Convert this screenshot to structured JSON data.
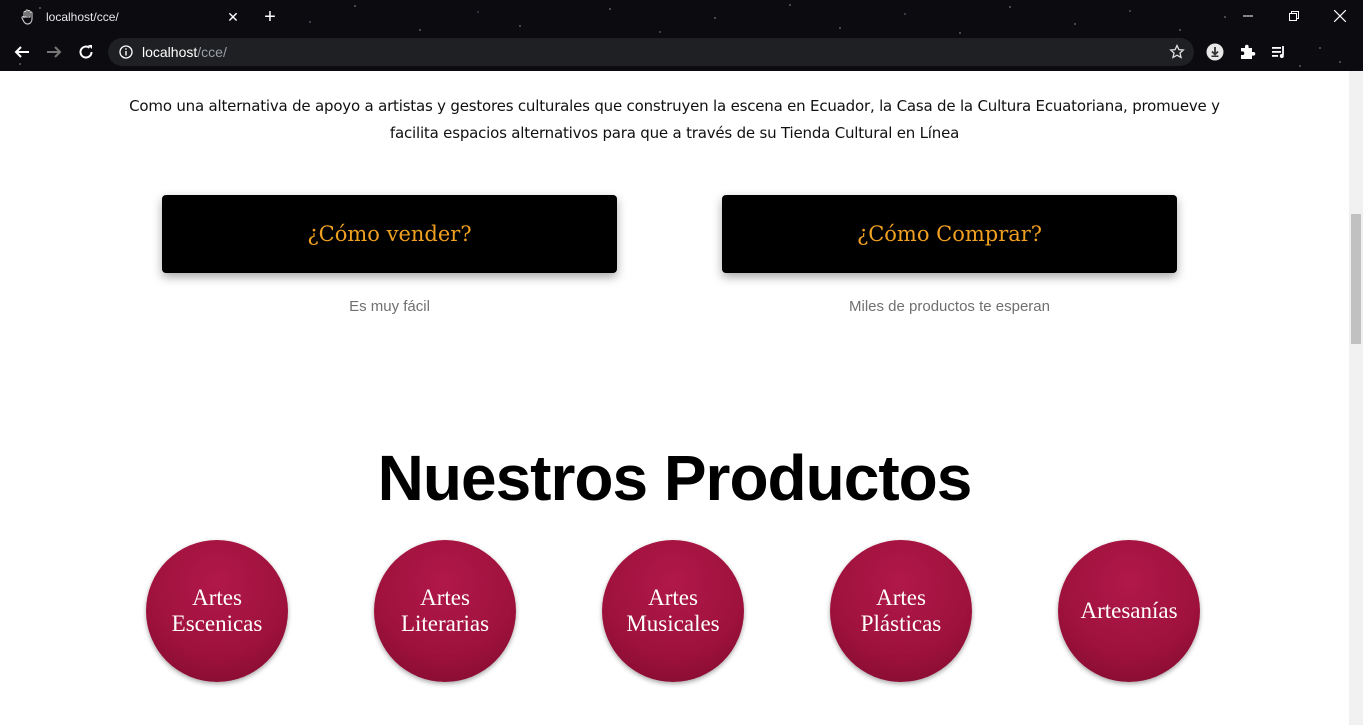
{
  "browser": {
    "tab_title": "localhost/cce/",
    "url_host": "localhost",
    "url_path": "/cce/"
  },
  "page": {
    "intro_text": "Como una alternativa de apoyo a artistas y gestores culturales que construyen la escena en Ecuador, la Casa de la Cultura Ecuatoriana, promueve y facilita espacios alternativos para que a través de su Tienda Cultural en Línea",
    "cta": [
      {
        "label": "¿Cómo vender?",
        "subtitle": "Es muy fácil"
      },
      {
        "label": "¿Cómo Comprar?",
        "subtitle": "Miles de productos te esperan"
      }
    ],
    "products_title": "Nuestros Productos",
    "products": [
      {
        "line1": "Artes",
        "line2": "Escenicas"
      },
      {
        "line1": "Artes",
        "line2": "Literarias"
      },
      {
        "line1": "Artes",
        "line2": "Musicales"
      },
      {
        "line1": "Artes",
        "line2": "Plásticas"
      },
      {
        "line1": "Artesanías",
        "line2": ""
      }
    ]
  },
  "colors": {
    "cta_text": "#f0a020",
    "product_circle": "#a0123e"
  }
}
